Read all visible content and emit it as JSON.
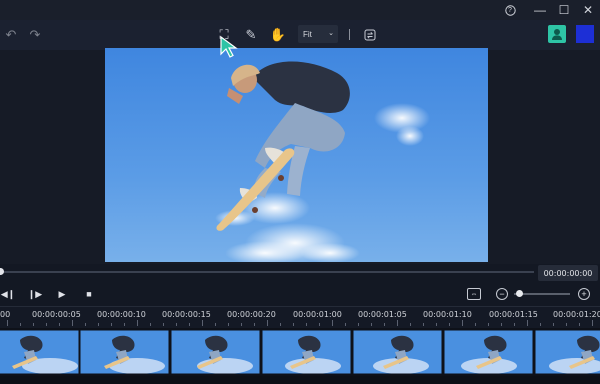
{
  "window": {
    "help_icon": "?",
    "minimize_icon": "—",
    "maximize_icon": "☐",
    "close_icon": "✕"
  },
  "toolbar": {
    "undo_icon": "↶",
    "redo_icon": "↷",
    "select_icon": "⛶",
    "draw_icon": "✎",
    "hand_icon": "✋",
    "zoom_value": "Fit",
    "zoom_chevron": "⌄",
    "swap_icon": "⇄"
  },
  "preview": {
    "timecode": "00:00:00:00"
  },
  "controls": {
    "prev_frame_icon": "◀❙",
    "next_frame_icon": "❙▶",
    "play_icon": "▶",
    "stop_icon": "■",
    "fit_icon": "⇔",
    "zoom_out_icon": "−",
    "zoom_in_icon": "+"
  },
  "ruler": {
    "labels": [
      "00",
      "00:00:00:05",
      "00:00:00:10",
      "00:00:00:15",
      "00:00:00:20",
      "00:00:01:00",
      "00:00:01:05",
      "00:00:01:10",
      "00:00:01:15",
      "00:00:01:20"
    ]
  },
  "colors": {
    "accent_teal": "#2ec4a6",
    "brand_blue": "#1d2fd6",
    "sky": "#5b9ce6"
  }
}
